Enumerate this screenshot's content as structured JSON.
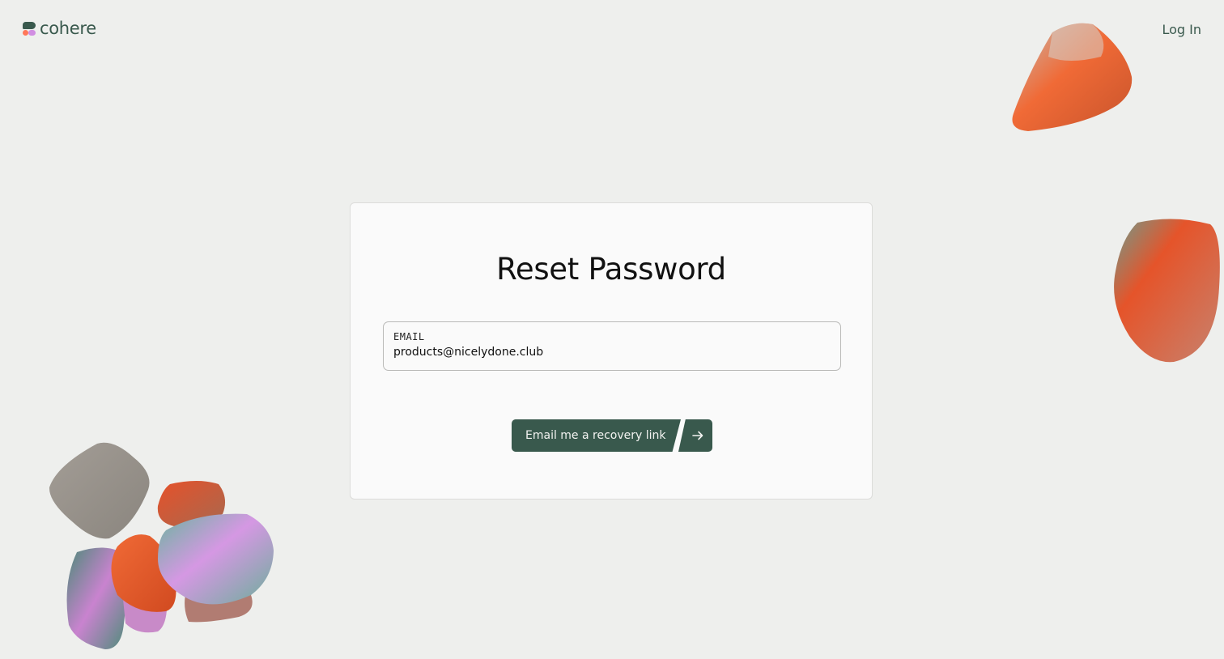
{
  "header": {
    "brand": "cohere",
    "login_label": "Log In"
  },
  "card": {
    "title": "Reset Password",
    "email_field": {
      "label": "EMAIL",
      "value": "products@nicelydone.club"
    },
    "submit_label": "Email me a recovery link"
  },
  "colors": {
    "background": "#eeefed",
    "brand_green": "#39594d",
    "accent_orange": "#ff7759",
    "accent_pink": "#d18ee2"
  },
  "icons": {
    "submit": "arrow-right-icon",
    "logo": "cohere-logo-icon"
  }
}
